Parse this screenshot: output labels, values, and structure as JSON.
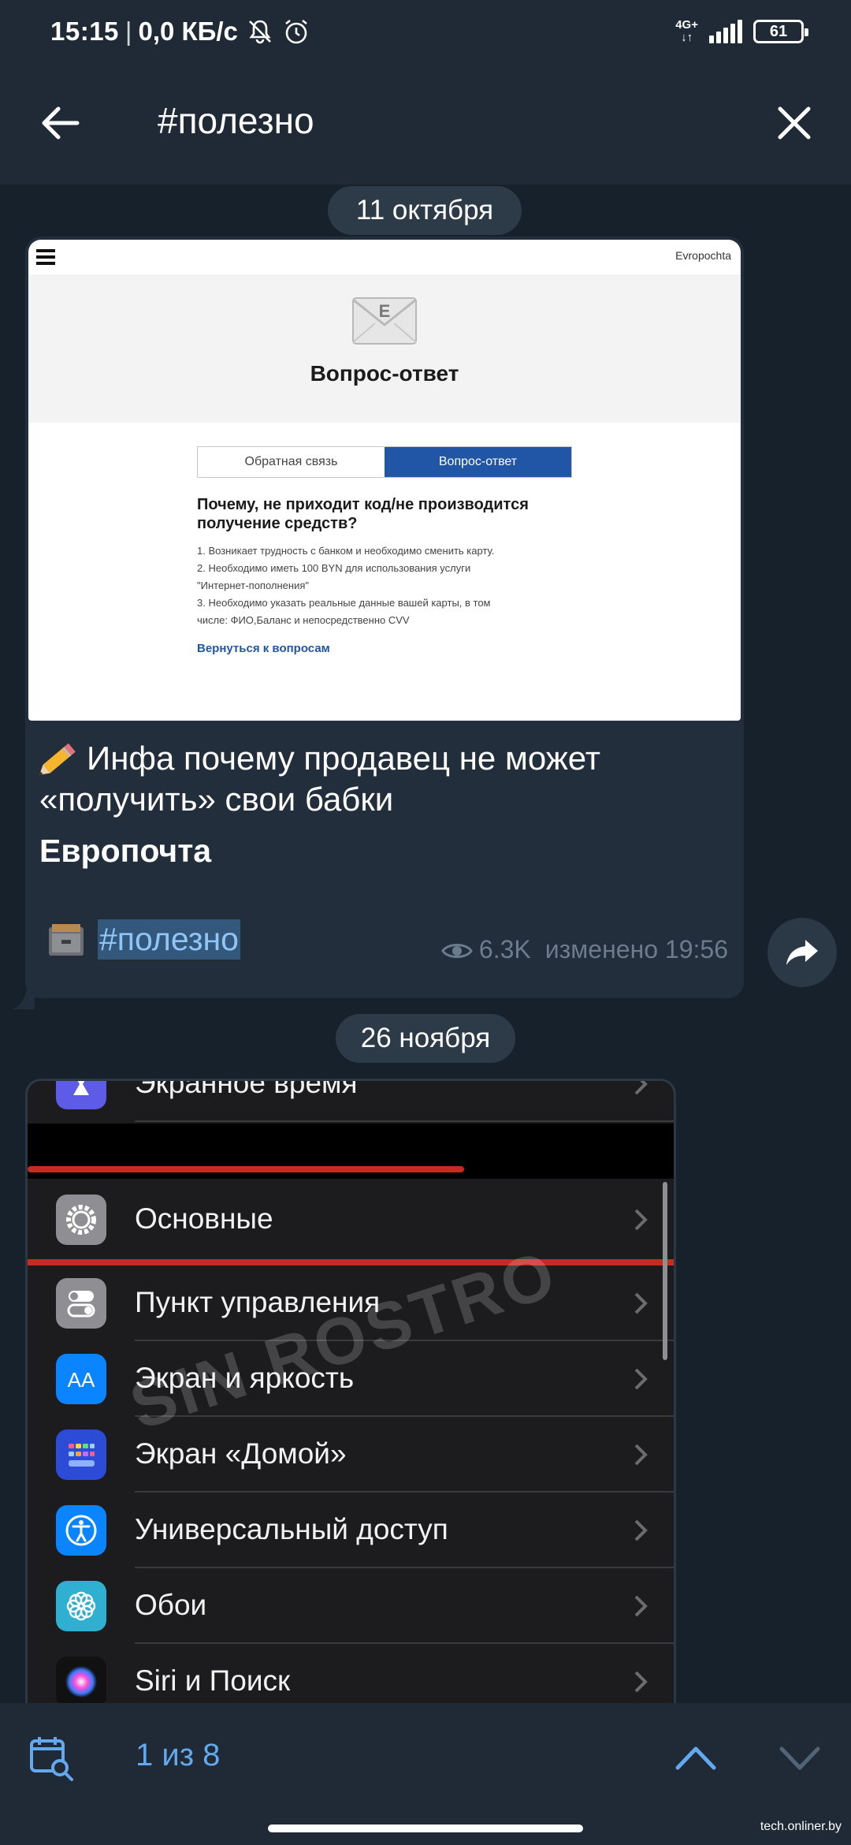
{
  "status_bar": {
    "time": "15:15",
    "speed": "0,0 КБ/с",
    "network_top": "4G+",
    "network_bottom": "↓↑",
    "battery": "61"
  },
  "header": {
    "title": "#полезно"
  },
  "chat": {
    "date_1": "11 октября",
    "date_2": "26 ноября",
    "message_1": {
      "photo": {
        "brand": "Evropochta",
        "title": "Вопрос-ответ",
        "tab_feedback": "Обратная связь",
        "tab_faq": "Вопрос-ответ",
        "question": "Почему, не приходит код/не производится получение средств?",
        "answers": [
          "1. Возникает трудность с банком и необходимо сменить карту.",
          "2. Необходимо иметь 100 BYN для использования услуги",
          "\"Интернет-пополнения\"",
          "3. Необходимо указать реальные данные вашей карты, в том",
          "числе: ФИО,Баланс и непосредственно CVV"
        ],
        "back_link": "Вернуться к вопросам"
      },
      "text": "Инфа почему продавец не может «получить» свои бабки",
      "subtitle": "Европочта",
      "hashtag": "#полезно",
      "views": "6.3K",
      "edited": "изменено 19:56"
    },
    "message_2": {
      "photo": {
        "watermark": "SIN ROSTRO",
        "items": [
          {
            "label": "Экранное время",
            "icon": "hourglass-icon",
            "color": "#5e5ce6"
          },
          {
            "label": "Основные",
            "icon": "gear-icon",
            "color": "#8e8e93"
          },
          {
            "label": "Пункт управления",
            "icon": "toggles-icon",
            "color": "#8e8e93"
          },
          {
            "label": "Экран и яркость",
            "icon": "text-size-icon",
            "color": "#0a84ff"
          },
          {
            "label": "Экран «Домой»",
            "icon": "home-grid-icon",
            "color": "#2c4bd6"
          },
          {
            "label": "Универсальный доступ",
            "icon": "accessibility-icon",
            "color": "#0a84ff"
          },
          {
            "label": "Обои",
            "icon": "flower-icon",
            "color": "#30b0d0"
          },
          {
            "label": "Siri и Поиск",
            "icon": "siri-icon",
            "color": "#111111"
          }
        ]
      }
    }
  },
  "search_bar": {
    "count": "1 из 8"
  },
  "credit": "tech.onliner.by",
  "colors": {
    "background": "#17212b",
    "bar": "#1f2a36",
    "bubble": "#222e3b",
    "accent": "#63a9f0",
    "hashtag_highlight": "#33587c"
  }
}
